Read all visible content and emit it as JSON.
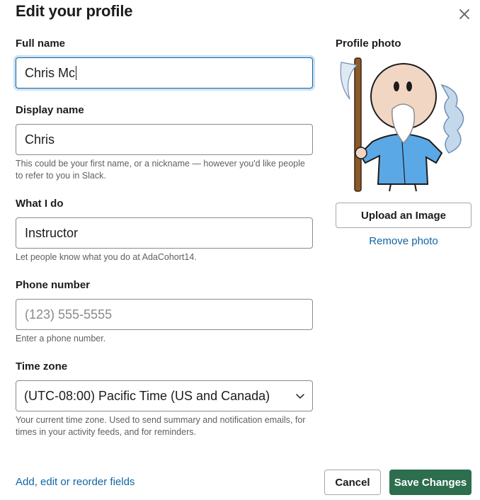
{
  "dialog": {
    "title": "Edit your profile"
  },
  "icons": {
    "close": "close-icon",
    "chevron": "chevron-down-icon"
  },
  "fields": {
    "full_name": {
      "label": "Full name",
      "value": "Chris Mc"
    },
    "display_name": {
      "label": "Display name",
      "value": "Chris",
      "help": "This could be your first name, or a nickname — however you'd like people to refer to you in Slack."
    },
    "what_i_do": {
      "label": "What I do",
      "value": "Instructor",
      "help": "Let people know what you do at AdaCohort14."
    },
    "phone": {
      "label": "Phone number",
      "placeholder": "(123) 555-5555",
      "help": "Enter a phone number."
    },
    "time_zone": {
      "label": "Time zone",
      "selected": "(UTC-08:00) Pacific Time (US and Canada)",
      "help": "Your current time zone. Used to send summary and notification emails, for times in your activity feeds, and for reminders."
    }
  },
  "photo": {
    "label": "Profile photo",
    "upload_label": "Upload an Image",
    "remove_label": "Remove photo"
  },
  "footer": {
    "fields_link": "Add, edit or reorder fields",
    "cancel_label": "Cancel",
    "save_label": "Save Changes"
  },
  "colors": {
    "link": "#1264a3",
    "save": "#2c6e4e",
    "focus": "#1264a3"
  }
}
